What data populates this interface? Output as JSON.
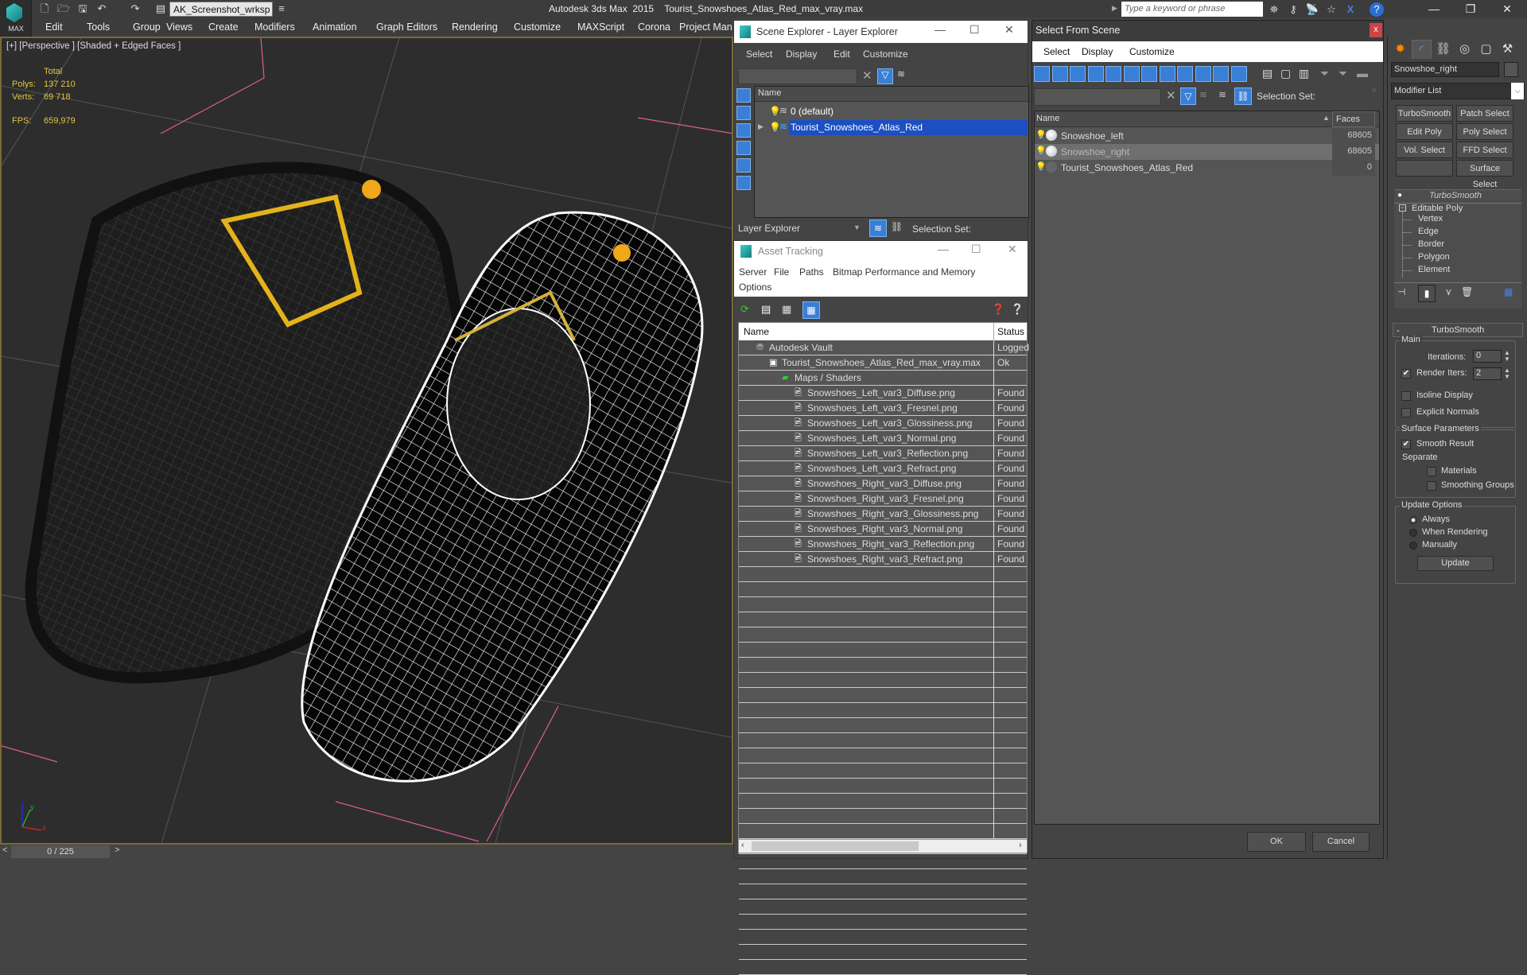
{
  "app": {
    "logo_label": "MAX",
    "workspace": "AK_Screenshot_wrksp",
    "title": "Autodesk 3ds Max  2015    Tourist_Snowshoes_Atlas_Red_max_vray.max",
    "search_placeholder": "Type a keyword or phrase"
  },
  "menu": [
    "Edit",
    "Tools",
    "Group",
    "Views",
    "Create",
    "Modifiers",
    "Animation",
    "Graph Editors",
    "Rendering",
    "Customize",
    "MAXScript",
    "Corona",
    "Project Man"
  ],
  "viewport": {
    "label": "[+] [Perspective ] [Shaded + Edged Faces ]",
    "stats": {
      "header": "Total",
      "polys_label": "Polys:",
      "polys": "137 210",
      "verts_label": "Verts:",
      "verts": "69 718",
      "fps_label": "FPS:",
      "fps": "659,979"
    },
    "axis": {
      "x": "x",
      "y": "y",
      "z": "z"
    },
    "colors": {
      "stats": "#e4c53c",
      "border": "#7a6a3a"
    }
  },
  "timeline": {
    "frame": "0 / 225",
    "prev": "<",
    "next": ">"
  },
  "scene_explorer": {
    "title": "Scene Explorer - Layer Explorer",
    "menu": [
      "Select",
      "Display",
      "Edit",
      "Customize"
    ],
    "column": "Name",
    "layers": [
      {
        "name": "0 (default)",
        "selected": false
      },
      {
        "name": "Tourist_Snowshoes_Atlas_Red",
        "selected": true
      }
    ],
    "mode": "Layer Explorer",
    "selection_set_label": "Selection Set:"
  },
  "asset_tracking": {
    "title": "Asset Tracking",
    "menu": [
      "Server",
      "File",
      "Paths",
      "Bitmap Performance and Memory"
    ],
    "menu2": [
      "Options"
    ],
    "columns": [
      "Name",
      "Status"
    ],
    "rows": [
      {
        "name": "Autodesk Vault",
        "status": "Logged",
        "level": 0,
        "icon": "vault-icon"
      },
      {
        "name": "Tourist_Snowshoes_Atlas_Red_max_vray.max",
        "status": "Ok",
        "level": 1,
        "icon": "max-file-icon"
      },
      {
        "name": "Maps / Shaders",
        "status": "",
        "level": 2,
        "icon": "maps-icon"
      },
      {
        "name": "Snowshoes_Left_var3_Diffuse.png",
        "status": "Found",
        "level": 3,
        "icon": "bitmap-icon"
      },
      {
        "name": "Snowshoes_Left_var3_Fresnel.png",
        "status": "Found",
        "level": 3,
        "icon": "bitmap-icon"
      },
      {
        "name": "Snowshoes_Left_var3_Glossiness.png",
        "status": "Found",
        "level": 3,
        "icon": "bitmap-icon"
      },
      {
        "name": "Snowshoes_Left_var3_Normal.png",
        "status": "Found",
        "level": 3,
        "icon": "bitmap-icon"
      },
      {
        "name": "Snowshoes_Left_var3_Reflection.png",
        "status": "Found",
        "level": 3,
        "icon": "bitmap-icon"
      },
      {
        "name": "Snowshoes_Left_var3_Refract.png",
        "status": "Found",
        "level": 3,
        "icon": "bitmap-icon"
      },
      {
        "name": "Snowshoes_Right_var3_Diffuse.png",
        "status": "Found",
        "level": 3,
        "icon": "bitmap-icon"
      },
      {
        "name": "Snowshoes_Right_var3_Fresnel.png",
        "status": "Found",
        "level": 3,
        "icon": "bitmap-icon"
      },
      {
        "name": "Snowshoes_Right_var3_Glossiness.png",
        "status": "Found",
        "level": 3,
        "icon": "bitmap-icon"
      },
      {
        "name": "Snowshoes_Right_var3_Normal.png",
        "status": "Found",
        "level": 3,
        "icon": "bitmap-icon"
      },
      {
        "name": "Snowshoes_Right_var3_Reflection.png",
        "status": "Found",
        "level": 3,
        "icon": "bitmap-icon"
      },
      {
        "name": "Snowshoes_Right_var3_Refract.png",
        "status": "Found",
        "level": 3,
        "icon": "bitmap-icon"
      }
    ]
  },
  "select_from_scene": {
    "title": "Select From Scene",
    "close": "x",
    "menu": [
      "Select",
      "Display",
      "Customize"
    ],
    "selection_set_label": "Selection Set:",
    "columns": [
      "Name",
      "Faces"
    ],
    "rows": [
      {
        "name": "Snowshoe_left",
        "faces": "68605",
        "selected": false
      },
      {
        "name": "Snowshoe_right",
        "faces": "68605",
        "selected": true
      },
      {
        "name": "Tourist_Snowshoes_Atlas_Red",
        "faces": "0",
        "selected": false
      }
    ],
    "ok": "OK",
    "cancel": "Cancel"
  },
  "command_panel": {
    "object_name": "Snowshoe_right",
    "modifier_list": "Modifier List",
    "buttons": [
      "TurboSmooth",
      "Patch Select",
      "Edit Poly",
      "Poly Select",
      "Vol. Select",
      "FFD Select",
      "",
      "Surface Select"
    ],
    "stack": {
      "top": "TurboSmooth",
      "base": "Editable Poly",
      "subobjects": [
        "Vertex",
        "Edge",
        "Border",
        "Polygon",
        "Element"
      ]
    },
    "rollout": {
      "title": "TurboSmooth",
      "collapse": "-",
      "main_label": "Main",
      "iterations_label": "Iterations:",
      "iterations": "0",
      "render_iters_label": "Render Iters:",
      "render_iters": "2",
      "render_iters_checked": true,
      "isoline_label": "Isoline Display",
      "isoline_checked": false,
      "explicit_normals_label": "Explicit Normals",
      "explicit_normals_checked": false,
      "surface_label": "Surface Parameters",
      "smooth_result_label": "Smooth Result",
      "smooth_result_checked": true,
      "separate_label": "Separate",
      "materials_label": "Materials",
      "materials_checked": false,
      "smoothing_groups_label": "Smoothing Groups",
      "smoothing_groups_checked": false,
      "update_label": "Update Options",
      "update_options": [
        "Always",
        "When Rendering",
        "Manually"
      ],
      "update_selected": "Always",
      "update_button": "Update"
    }
  }
}
